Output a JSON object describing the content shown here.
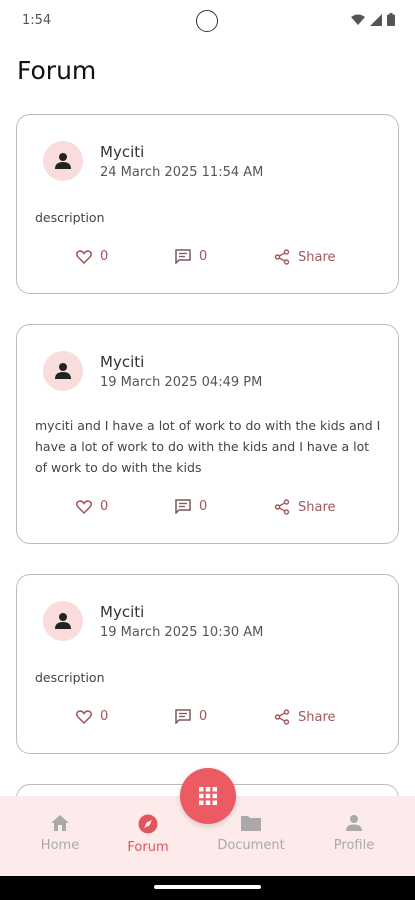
{
  "status_bar": {
    "time": "1:54"
  },
  "page": {
    "title": "Forum"
  },
  "posts": [
    {
      "author": "Myciti",
      "date": "24 March 2025 11:54 AM",
      "body": "description",
      "likes": "0",
      "comments": "0",
      "share_label": "Share"
    },
    {
      "author": "Myciti",
      "date": "19 March 2025 04:49 PM",
      "body": "myciti and I have a lot of work to do with the kids and I have a lot of work to do with the kids and I have a lot of work to do with the kids",
      "likes": "0",
      "comments": "0",
      "share_label": "Share"
    },
    {
      "author": "Myciti",
      "date": "19 March 2025 10:30 AM",
      "body": "description",
      "likes": "0",
      "comments": "0",
      "share_label": "Share"
    }
  ],
  "bottom_nav": {
    "items": [
      {
        "label": "Home",
        "icon": "home-icon"
      },
      {
        "label": "Forum",
        "icon": "compass-icon",
        "active": true
      },
      {
        "label": "Document",
        "icon": "folder-icon"
      },
      {
        "label": "Profile",
        "icon": "person-icon"
      }
    ],
    "fab_icon": "grid-icon"
  },
  "colors": {
    "accent": "#ec5a62",
    "avatar_bg": "#f9dcdc",
    "nav_bg": "#fdeaea",
    "action": "#a4565b"
  }
}
